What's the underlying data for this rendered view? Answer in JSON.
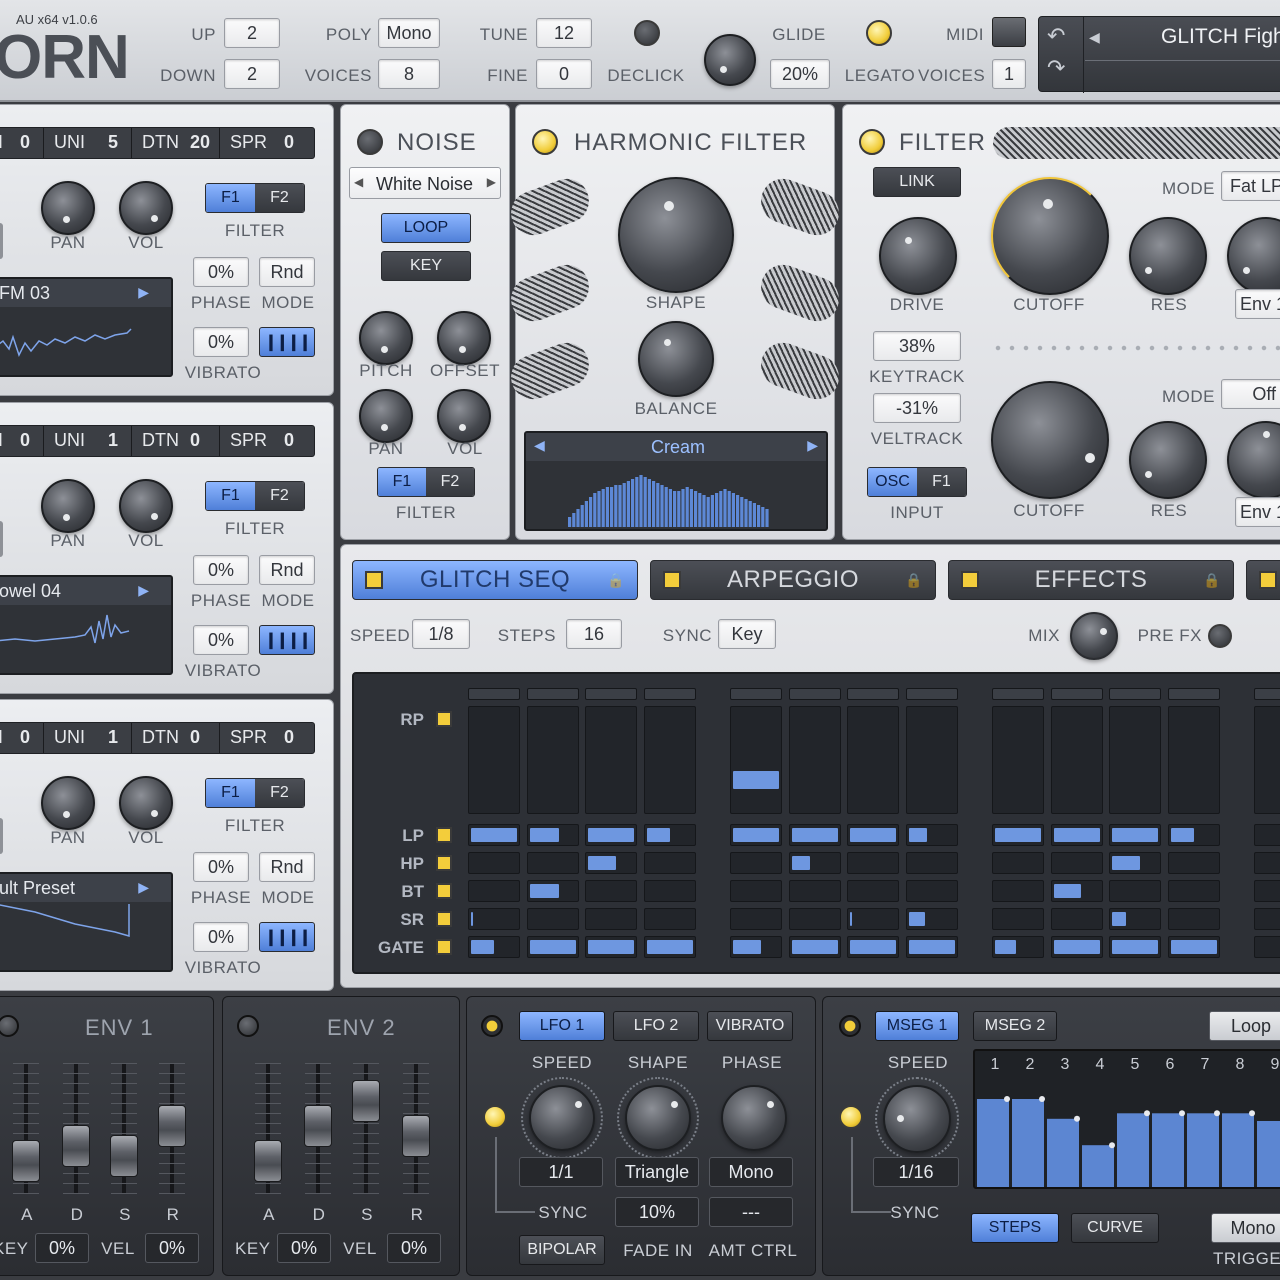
{
  "header": {
    "version": "AU x64 v1.0.6",
    "logo_text": "ORN",
    "up_label": "UP",
    "up_value": "2",
    "down_label": "DOWN",
    "down_value": "2",
    "poly_label": "POLY",
    "poly_value": "Mono",
    "voices_label": "VOICES",
    "voices_value": "8",
    "tune_label": "TUNE",
    "tune_value": "12",
    "fine_label": "FINE",
    "fine_value": "0",
    "declick_label": "DECLICK",
    "glide_label": "GLIDE",
    "glide_value": "20%",
    "legato_label": "LEGATO",
    "midi_label": "MIDI",
    "midi_voices_label": "VOICES",
    "midi_voices_value": "1",
    "preset_name": "GLITCH Fight"
  },
  "oscillators": [
    {
      "strip": [
        "I",
        "0",
        "UNI",
        "5",
        "DTN",
        "20",
        "SPR",
        "0"
      ],
      "pan": "PAN",
      "vol": "VOL",
      "f1": "F1",
      "f2": "F2",
      "filter": "FILTER",
      "wave_name": "FM 03",
      "phase_value": "0%",
      "phase": "PHASE",
      "mode_value": "Rnd",
      "mode": "MODE",
      "vibrato_value": "0%",
      "vibrato": "VIBRATO"
    },
    {
      "strip": [
        "I",
        "0",
        "UNI",
        "1",
        "DTN",
        "0",
        "SPR",
        "0"
      ],
      "pan": "PAN",
      "vol": "VOL",
      "f1": "F1",
      "f2": "F2",
      "filter": "FILTER",
      "wave_name": "owel 04",
      "phase_value": "0%",
      "phase": "PHASE",
      "mode_value": "Rnd",
      "mode": "MODE",
      "vibrato_value": "0%",
      "vibrato": "VIBRATO"
    },
    {
      "strip": [
        "I",
        "0",
        "UNI",
        "1",
        "DTN",
        "0",
        "SPR",
        "0"
      ],
      "pan": "PAN",
      "vol": "VOL",
      "f1": "F1",
      "f2": "F2",
      "filter": "FILTER",
      "wave_name": "ult Preset",
      "phase_value": "0%",
      "phase": "PHASE",
      "mode_value": "Rnd",
      "mode": "MODE",
      "vibrato_value": "0%",
      "vibrato": "VIBRATO"
    }
  ],
  "noise": {
    "title": "NOISE",
    "type": "White Noise",
    "loop": "LOOP",
    "key": "KEY",
    "pitch": "PITCH",
    "offset": "OFFSET",
    "pan": "PAN",
    "vol": "VOL",
    "f1": "F1",
    "f2": "F2",
    "filter": "FILTER"
  },
  "harmonic": {
    "title": "HARMONIC FILTER",
    "shape": "SHAPE",
    "balance": "BALANCE",
    "preset": "Cream"
  },
  "filter": {
    "title": "FILTER",
    "link": "LINK",
    "mode_label": "MODE",
    "mode_value": "Fat LP",
    "drive": "DRIVE",
    "cutoff": "CUTOFF",
    "res": "RES",
    "env": "Env 1",
    "keytrack_value": "38%",
    "keytrack": "KEYTRACK",
    "veltrack_value": "-31%",
    "veltrack": "VELTRACK",
    "mode2_label": "MODE",
    "mode2_value": "Off",
    "osc": "OSC",
    "f1": "F1",
    "input": "INPUT",
    "cutoff2": "CUTOFF",
    "res2": "RES",
    "env2": "Env 1"
  },
  "tabs": [
    {
      "label": "GLITCH SEQ",
      "active": true
    },
    {
      "label": "ARPEGGIO",
      "active": false
    },
    {
      "label": "EFFECTS",
      "active": false
    }
  ],
  "seq": {
    "speed_label": "SPEED",
    "speed_value": "1/8",
    "steps_label": "STEPS",
    "steps_value": "16",
    "sync_label": "SYNC",
    "sync_value": "Key",
    "mix_label": "MIX",
    "prefx_label": "PRE FX",
    "rows": [
      "RP",
      "LP",
      "HP",
      "BT",
      "SR",
      "GATE"
    ],
    "rp": [
      0,
      0,
      0,
      0,
      0.2,
      0,
      0,
      0,
      0,
      0,
      0,
      0
    ],
    "lp": [
      1,
      0.65,
      1,
      0.5,
      1,
      1,
      1,
      0.4,
      1,
      1,
      1,
      0.5
    ],
    "hp": [
      0,
      0,
      0.6,
      0,
      0,
      0.4,
      0,
      0,
      0,
      0,
      0.6,
      0
    ],
    "bt": [
      0,
      0.65,
      0,
      0,
      0,
      0,
      0,
      0,
      0,
      0.6,
      0,
      0
    ],
    "sr": [
      0.05,
      0,
      0,
      0,
      0,
      0,
      0.03,
      0.35,
      0,
      0,
      0.3,
      0
    ],
    "gate": [
      0.5,
      1,
      1,
      1,
      0.6,
      1,
      1,
      1,
      0.45,
      1,
      1,
      1
    ]
  },
  "env1": {
    "title": "ENV 1",
    "a": "A",
    "d": "D",
    "s": "S",
    "r": "R",
    "key_label": "KEY",
    "key_value": "0%",
    "vel_label": "VEL",
    "vel_value": "0%",
    "levels": [
      0.15,
      0.3,
      0.2,
      0.5
    ]
  },
  "env2": {
    "title": "ENV 2",
    "a": "A",
    "d": "D",
    "s": "S",
    "r": "R",
    "key_label": "KEY",
    "key_value": "0%",
    "vel_label": "VEL",
    "vel_value": "0%",
    "levels": [
      0.15,
      0.5,
      0.75,
      0.4
    ]
  },
  "lfo": {
    "tab1": "LFO 1",
    "tab2": "LFO 2",
    "tab3": "VIBRATO",
    "speed": "SPEED",
    "shape": "SHAPE",
    "phase": "PHASE",
    "speed_value": "1/1",
    "shape_value": "Triangle",
    "phase_value": "Mono",
    "sync": "SYNC",
    "fadein_value": "10%",
    "amt_value": "---",
    "bipolar": "BIPOLAR",
    "fadein": "FADE IN",
    "amtctrl": "AMT CTRL"
  },
  "mseg": {
    "tab1": "MSEG 1",
    "tab2": "MSEG 2",
    "loop": "Loop",
    "speed": "SPEED",
    "speed_value": "1/16",
    "sync": "SYNC",
    "steps": "STEPS",
    "curve": "CURVE",
    "trigger_value": "Mono",
    "trigger": "TRIGGER",
    "step_numbers": [
      "1",
      "2",
      "3",
      "4",
      "5",
      "6",
      "7",
      "8",
      "9"
    ],
    "step_values": [
      0.8,
      0.8,
      0.62,
      0.38,
      0.67,
      0.67,
      0.67,
      0.67,
      0.6
    ]
  }
}
